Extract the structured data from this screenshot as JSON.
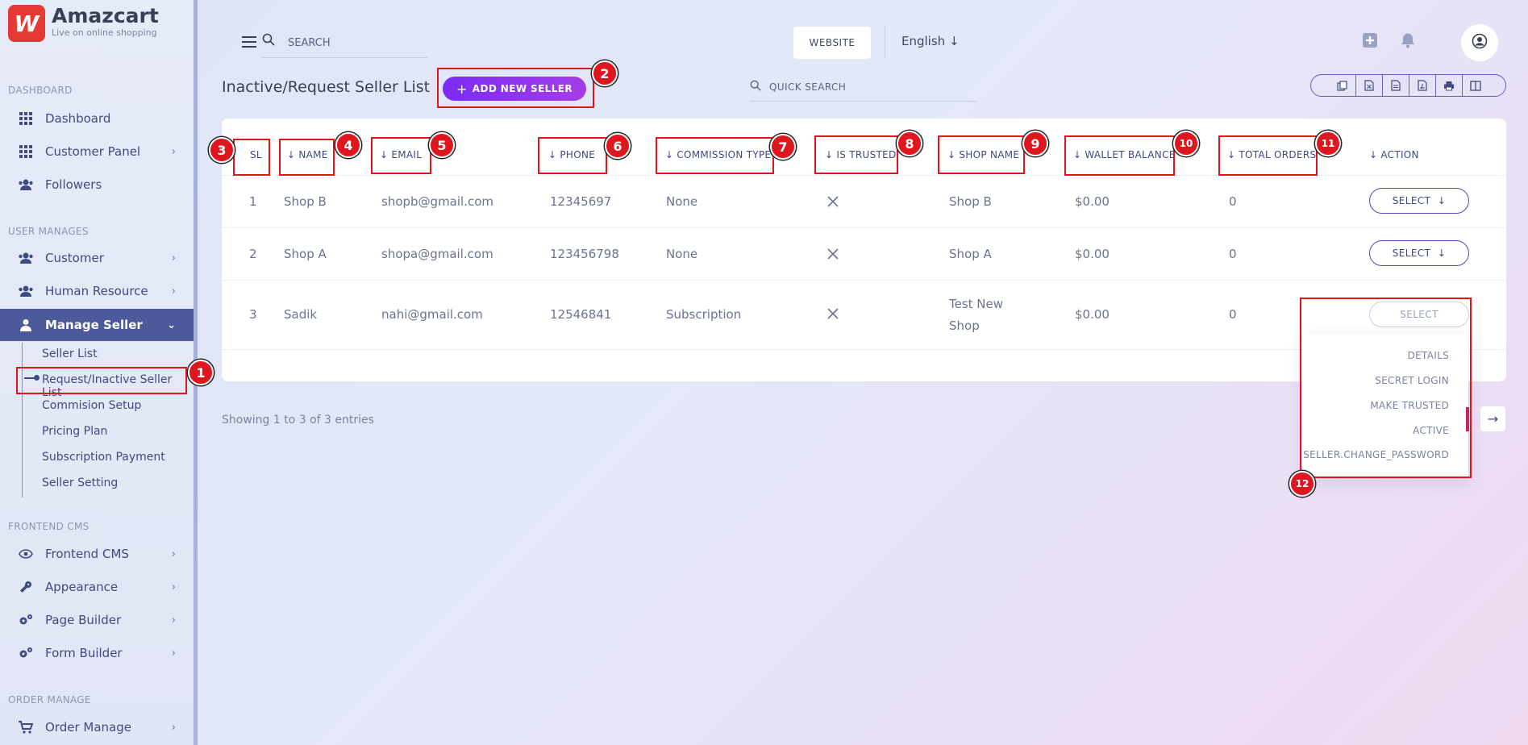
{
  "brand": {
    "logo_letter": "W",
    "name": "Amazcart",
    "tagline": "Live on online shopping"
  },
  "sidebar": {
    "sections": {
      "dashboard": "DASHBOARD",
      "user_manages": "USER MANAGES",
      "frontend_cms": "FRONTEND CMS",
      "order_manages": "ORDER MANAGE"
    },
    "items": [
      {
        "label": "Dashboard",
        "icon": "grid-icon"
      },
      {
        "label": "Customer Panel",
        "icon": "grid-icon"
      },
      {
        "label": "Followers",
        "icon": "users-icon"
      },
      {
        "label": "Customer",
        "icon": "users-icon"
      },
      {
        "label": "Human Resource",
        "icon": "users-icon"
      },
      {
        "label": "Manage Seller",
        "icon": "user-icon"
      },
      {
        "label": "Frontend CMS",
        "icon": "eye-icon"
      },
      {
        "label": "Appearance",
        "icon": "wrench-icon"
      },
      {
        "label": "Page Builder",
        "icon": "gears-icon"
      },
      {
        "label": "Form Builder",
        "icon": "gears-icon"
      },
      {
        "label": "Order Manage",
        "icon": "cart-icon"
      }
    ],
    "sub_items": [
      "Seller List",
      "Request/Inactive Seller List",
      "Commision Setup",
      "Pricing Plan",
      "Subscription Payment",
      "Seller Setting"
    ]
  },
  "header": {
    "search_placeholder": "SEARCH",
    "website_label": "WEBSITE",
    "language": "English"
  },
  "page": {
    "title": "Inactive/Request Seller List",
    "add_button": "ADD NEW SELLER",
    "quick_search_placeholder": "QUICK SEARCH",
    "entries_text": "Showing 1 to 3 of 3 entries"
  },
  "table": {
    "columns": [
      "SL",
      "NAME",
      "EMAIL",
      "PHONE",
      "COMMISSION TYPE",
      "IS TRUSTED",
      "SHOP NAME",
      "WALLET BALANCE",
      "TOTAL ORDERS",
      "ACTION"
    ],
    "rows": [
      {
        "sl": "1",
        "name": "Shop B",
        "email": "shopb@gmail.com",
        "phone": "12345697",
        "commission": "None",
        "shop_line1": "Shop B",
        "shop_line2": "",
        "wallet": "$0.00",
        "orders": "0"
      },
      {
        "sl": "2",
        "name": "Shop A",
        "email": "shopa@gmail.com",
        "phone": "123456798",
        "commission": "None",
        "shop_line1": "Shop A",
        "shop_line2": "",
        "wallet": "$0.00",
        "orders": "0"
      },
      {
        "sl": "3",
        "name": "Sadik",
        "email": "nahi@gmail.com",
        "phone": "12546841",
        "commission": "Subscription",
        "shop_line1": "Test New",
        "shop_line2": "Shop",
        "wallet": "$0.00",
        "orders": "0"
      }
    ],
    "select_label": "SELECT"
  },
  "dropdown": [
    "DETAILS",
    "SECRET LOGIN",
    "MAKE TRUSTED",
    "ACTIVE",
    "SELLER.CHANGE_PASSWORD"
  ],
  "annotations": [
    "1",
    "2",
    "3",
    "4",
    "5",
    "6",
    "7",
    "8",
    "9",
    "10",
    "11",
    "12"
  ],
  "colors": {
    "accent": "#7a2cf5",
    "active_nav": "#4c5a9c",
    "annotation": "#e0161e"
  }
}
